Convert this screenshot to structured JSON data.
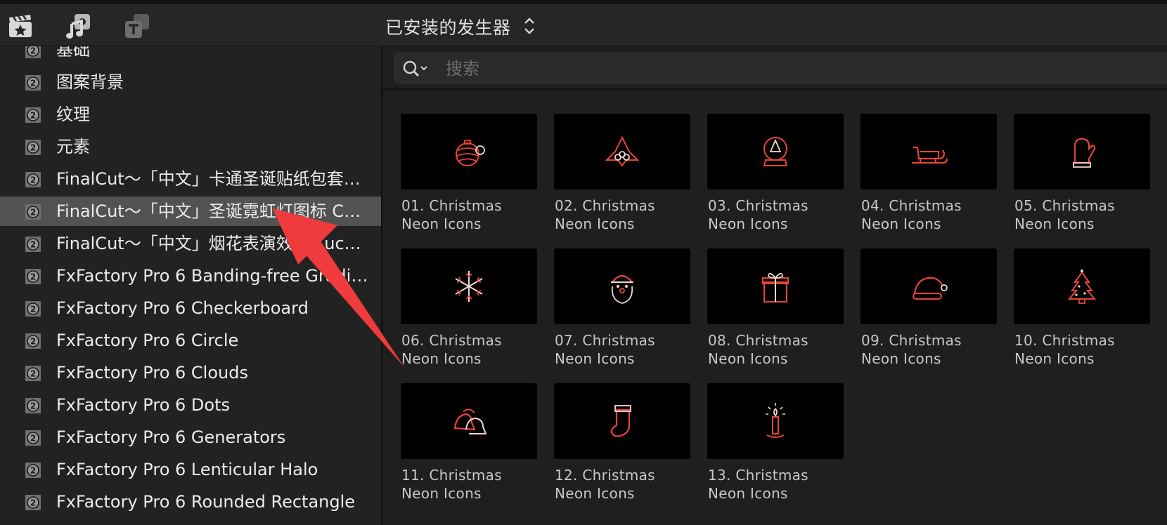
{
  "toolbar": {
    "title": "已安装的发生器",
    "icons": [
      "clapper-star-icon",
      "photos-music-icon",
      "titles-icon"
    ]
  },
  "sidebar": {
    "items": [
      {
        "label": "基础"
      },
      {
        "label": "图案背景"
      },
      {
        "label": "纹理"
      },
      {
        "label": "元素"
      },
      {
        "label": "FinalCut～「中文」卡通圣诞贴纸包套…"
      },
      {
        "label": "FinalCut～「中文」圣诞霓虹灯图标 C…",
        "selected": true
      },
      {
        "label": "FinalCut～「中文」烟花表演效果 Luc…"
      },
      {
        "label": "FxFactory Pro 6 Banding-free Gradi…"
      },
      {
        "label": "FxFactory Pro 6 Checkerboard"
      },
      {
        "label": "FxFactory Pro 6 Circle"
      },
      {
        "label": "FxFactory Pro 6 Clouds"
      },
      {
        "label": "FxFactory Pro 6 Dots"
      },
      {
        "label": "FxFactory Pro 6 Generators"
      },
      {
        "label": "FxFactory Pro 6 Lenticular Halo"
      },
      {
        "label": "FxFactory Pro 6 Rounded Rectangle"
      }
    ]
  },
  "search": {
    "placeholder": "搜索"
  },
  "generators": [
    {
      "line1": "01. Christmas",
      "line2": "Neon Icons",
      "icon": "ornament-icon"
    },
    {
      "line1": "02. Christmas",
      "line2": "Neon Icons",
      "icon": "holly-icon"
    },
    {
      "line1": "03. Christmas",
      "line2": "Neon Icons",
      "icon": "snow-globe-icon"
    },
    {
      "line1": "04. Christmas",
      "line2": "Neon Icons",
      "icon": "sleigh-icon"
    },
    {
      "line1": "05. Christmas",
      "line2": "Neon Icons",
      "icon": "mitten-icon"
    },
    {
      "line1": "06. Christmas",
      "line2": "Neon Icons",
      "icon": "snowflake-icon"
    },
    {
      "line1": "07. Christmas",
      "line2": "Neon Icons",
      "icon": "santa-icon"
    },
    {
      "line1": "08. Christmas",
      "line2": "Neon Icons",
      "icon": "gift-icon"
    },
    {
      "line1": "09. Christmas",
      "line2": "Neon Icons",
      "icon": "santa-hat-icon"
    },
    {
      "line1": "10. Christmas",
      "line2": "Neon Icons",
      "icon": "christmas-tree-icon"
    },
    {
      "line1": "11. Christmas",
      "line2": "Neon Icons",
      "icon": "bells-icon"
    },
    {
      "line1": "12. Christmas",
      "line2": "Neon Icons",
      "icon": "stocking-icon"
    },
    {
      "line1": "13. Christmas",
      "line2": "Neon Icons",
      "icon": "candle-icon"
    }
  ],
  "colors": {
    "neon": "#e8433b",
    "neon_white": "#f2d7d2",
    "annotation_arrow": "#ef3b3b",
    "selected_row": "#525252"
  }
}
